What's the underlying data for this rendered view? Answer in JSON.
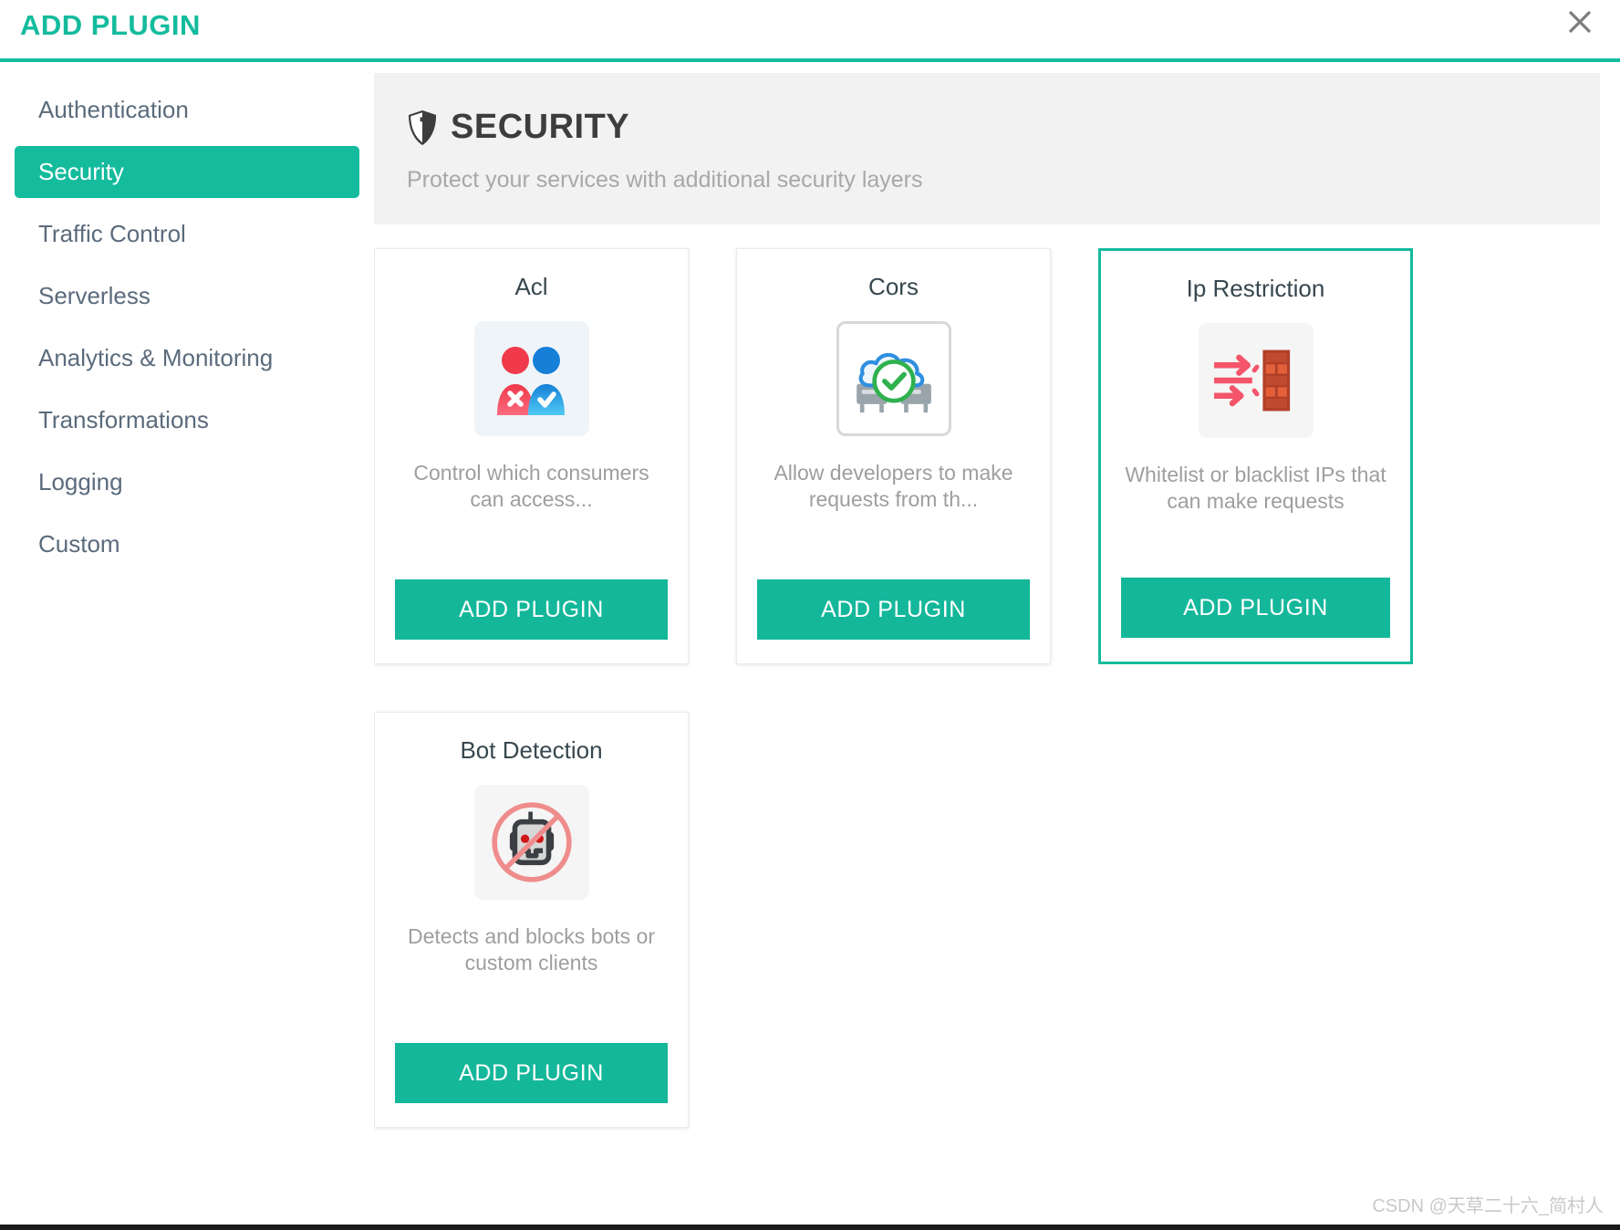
{
  "dialog": {
    "title": "ADD PLUGIN",
    "close_icon": "close-icon"
  },
  "sidebar": {
    "items": [
      {
        "label": "Authentication",
        "active": false
      },
      {
        "label": "Security",
        "active": true
      },
      {
        "label": "Traffic Control",
        "active": false
      },
      {
        "label": "Serverless",
        "active": false
      },
      {
        "label": "Analytics & Monitoring",
        "active": false
      },
      {
        "label": "Transformations",
        "active": false
      },
      {
        "label": "Logging",
        "active": false
      },
      {
        "label": "Custom",
        "active": false
      }
    ]
  },
  "section": {
    "icon": "shield-icon",
    "title": "SECURITY",
    "subtitle": "Protect your services with additional security layers"
  },
  "cards": [
    {
      "title": "Acl",
      "icon": "two-users-allow-deny-icon",
      "description": "Control which consumers can access...",
      "button_label": "ADD PLUGIN",
      "selected": false
    },
    {
      "title": "Cors",
      "icon": "cloud-check-server-icon",
      "description": "Allow developers to make requests from th...",
      "button_label": "ADD PLUGIN",
      "selected": false
    },
    {
      "title": "Ip Restriction",
      "icon": "arrows-firewall-icon",
      "description": "Whitelist or blacklist IPs that can make requests",
      "button_label": "ADD PLUGIN",
      "selected": true
    },
    {
      "title": "Bot Detection",
      "icon": "no-robot-icon",
      "description": "Detects and blocks bots or custom clients",
      "button_label": "ADD PLUGIN",
      "selected": false
    }
  ],
  "watermark": {
    "text": "CSDN @天草二十六_简村人"
  },
  "colors": {
    "accent": "#14bb9d",
    "button": "#14b79a",
    "sidebar_text": "#5b6b7c",
    "card_title": "#37474f",
    "muted_text": "#9e9e9e",
    "banner_bg": "#f2f2f2"
  }
}
